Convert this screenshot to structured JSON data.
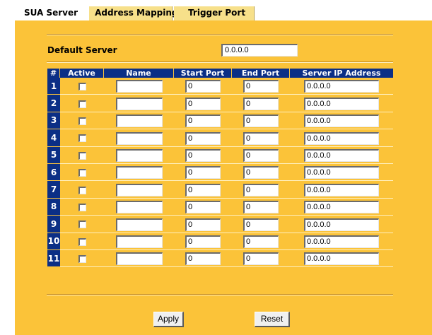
{
  "tabs": [
    {
      "label": "SUA Server",
      "active": true
    },
    {
      "label": "Address Mapping",
      "active": false
    },
    {
      "label": "Trigger Port",
      "active": false
    }
  ],
  "default_server": {
    "label": "Default Server",
    "value": "0.0.0.0"
  },
  "table": {
    "columns": [
      "#",
      "Active",
      "Name",
      "Start Port",
      "End Port",
      "Server IP Address"
    ],
    "rows": [
      {
        "num": "1",
        "active": false,
        "name": "",
        "start_port": "0",
        "end_port": "0",
        "server_ip": "0.0.0.0"
      },
      {
        "num": "2",
        "active": false,
        "name": "",
        "start_port": "0",
        "end_port": "0",
        "server_ip": "0.0.0.0"
      },
      {
        "num": "3",
        "active": false,
        "name": "",
        "start_port": "0",
        "end_port": "0",
        "server_ip": "0.0.0.0"
      },
      {
        "num": "4",
        "active": false,
        "name": "",
        "start_port": "0",
        "end_port": "0",
        "server_ip": "0.0.0.0"
      },
      {
        "num": "5",
        "active": false,
        "name": "",
        "start_port": "0",
        "end_port": "0",
        "server_ip": "0.0.0.0"
      },
      {
        "num": "6",
        "active": false,
        "name": "",
        "start_port": "0",
        "end_port": "0",
        "server_ip": "0.0.0.0"
      },
      {
        "num": "7",
        "active": false,
        "name": "",
        "start_port": "0",
        "end_port": "0",
        "server_ip": "0.0.0.0"
      },
      {
        "num": "8",
        "active": false,
        "name": "",
        "start_port": "0",
        "end_port": "0",
        "server_ip": "0.0.0.0"
      },
      {
        "num": "9",
        "active": false,
        "name": "",
        "start_port": "0",
        "end_port": "0",
        "server_ip": "0.0.0.0"
      },
      {
        "num": "10",
        "active": false,
        "name": "",
        "start_port": "0",
        "end_port": "0",
        "server_ip": "0.0.0.0"
      },
      {
        "num": "11",
        "active": false,
        "name": "",
        "start_port": "0",
        "end_port": "0",
        "server_ip": "0.0.0.0"
      }
    ]
  },
  "buttons": {
    "apply": "Apply",
    "reset": "Reset"
  },
  "colors": {
    "panel_bg": "#fbc339",
    "header_bg": "#0b2f86",
    "inactive_tab_bg": "#f7e08a"
  }
}
